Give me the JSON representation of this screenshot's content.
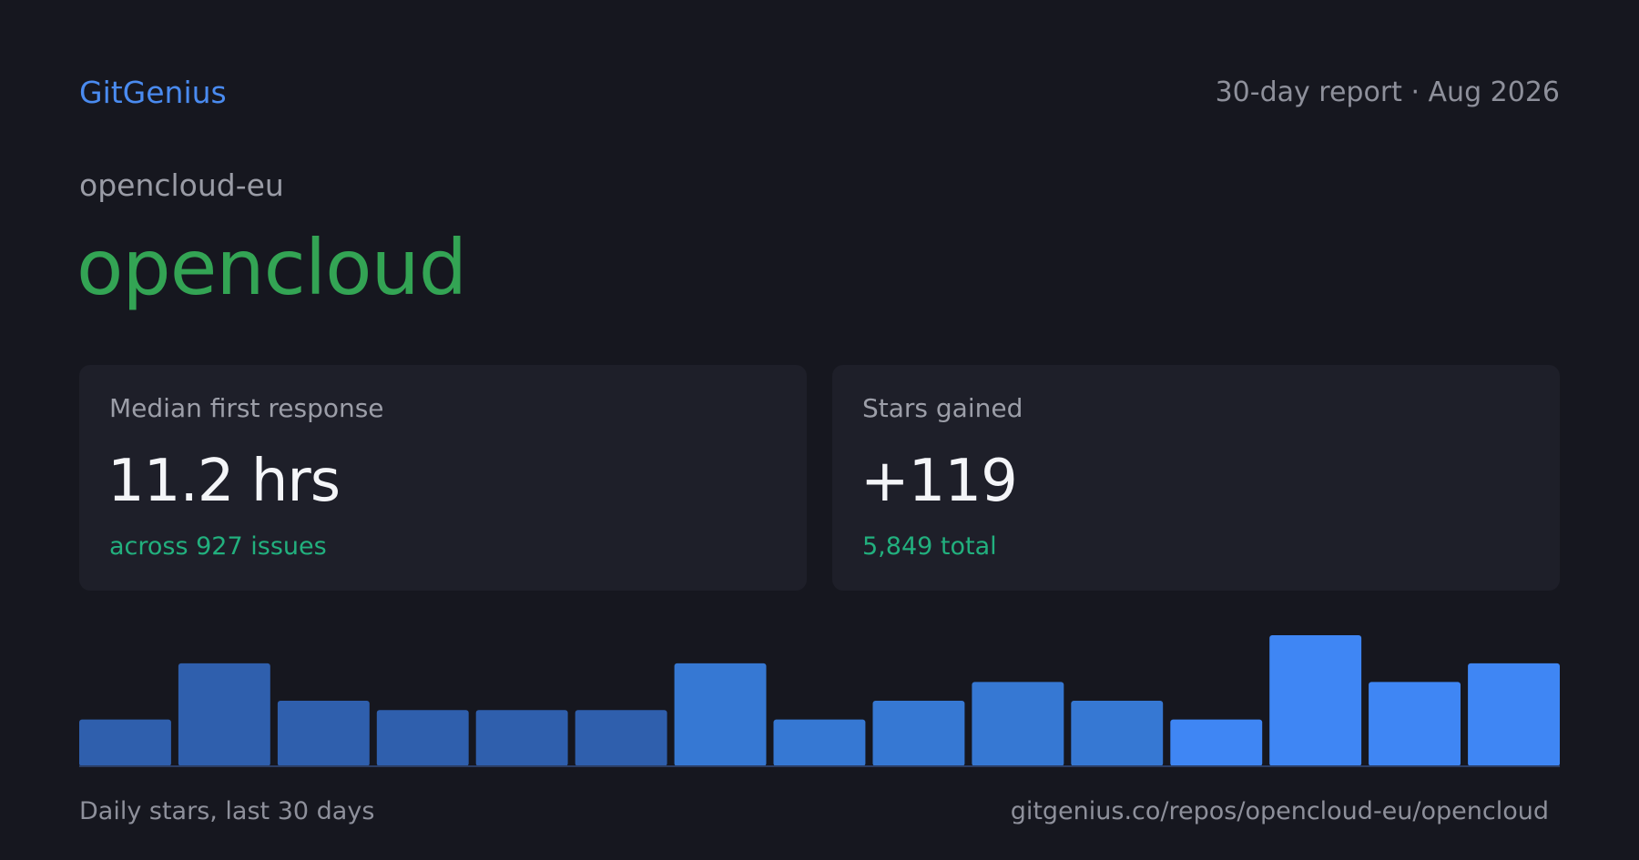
{
  "header": {
    "brand": "GitGenius",
    "report_label": "30-day report · Aug 2026"
  },
  "repo": {
    "owner": "opencloud-eu",
    "name": "opencloud"
  },
  "stats": {
    "response": {
      "label": "Median first response",
      "value": "11.2 hrs",
      "sub": "across 927 issues"
    },
    "stars": {
      "label": "Stars gained",
      "value": "+119",
      "sub": "5,849 total"
    }
  },
  "footer": {
    "caption": "Daily stars, last 30 days",
    "url": "gitgenius.co/repos/opencloud-eu/opencloud"
  },
  "colors": {
    "brand": "#4a8bf0",
    "repo_name": "#33a454",
    "accent_sub": "#22b07e",
    "bars": [
      "#2f5fad",
      "#2f5fad",
      "#2f5fad",
      "#2f5fad",
      "#2f5fad",
      "#2f5fad",
      "#3678d3",
      "#3678d3",
      "#3678d3",
      "#3678d3",
      "#3678d3",
      "#3f86f4",
      "#3f86f4",
      "#3f86f4",
      "#3f86f4"
    ]
  },
  "chart_data": {
    "type": "bar",
    "values": [
      5,
      11,
      7,
      6,
      6,
      6,
      11,
      5,
      7,
      9,
      7,
      5,
      14,
      9,
      11
    ],
    "ylim": [
      0,
      14
    ],
    "grid": false,
    "legend": "none"
  }
}
